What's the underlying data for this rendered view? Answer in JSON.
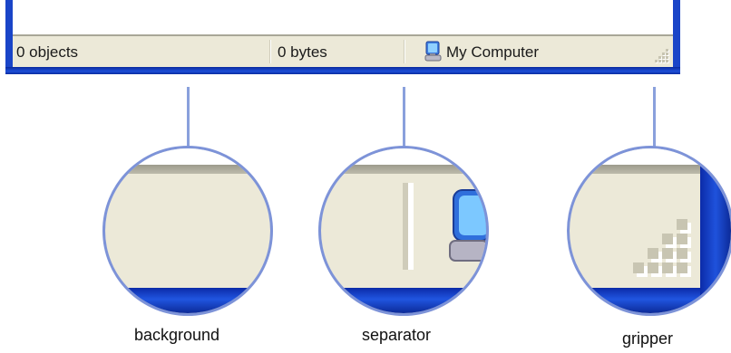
{
  "statusbar": {
    "objects": "0 objects",
    "bytes": "0 bytes",
    "zone": "My Computer",
    "zone_icon": "computer-icon"
  },
  "callouts": [
    {
      "label": "background"
    },
    {
      "label": "separator"
    },
    {
      "label": "gripper"
    }
  ],
  "colors": {
    "frame_blue": "#1a45c8",
    "statusbar_bg": "#ece9d8",
    "callout_line": "#8aa0dc"
  }
}
